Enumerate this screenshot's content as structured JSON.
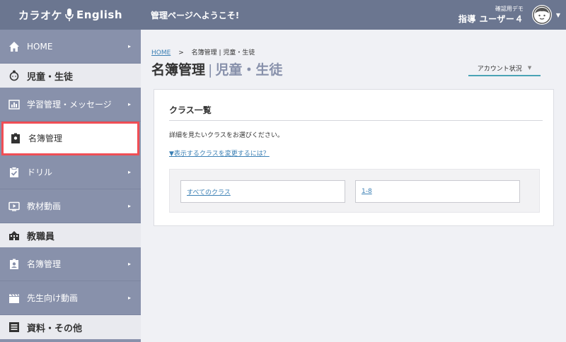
{
  "header": {
    "logo_left": "カラオケ",
    "logo_right": "English",
    "welcome": "管理ページへようこそ!",
    "user_sub": "確認用デモ",
    "user_name": "指導 ユーザー４"
  },
  "sidebar": {
    "home": "HOME",
    "section_students": "児童・生徒",
    "learning": "学習管理・メッセージ",
    "roster": "名簿管理",
    "drill": "ドリル",
    "video": "教材動画",
    "section_staff": "教職員",
    "staff_roster": "名簿管理",
    "teacher_video": "先生向け動画",
    "section_materials": "資料・その他"
  },
  "breadcrumb": {
    "home": "HOME",
    "sep": ">",
    "current": "名簿管理 | 児童・生徒"
  },
  "page": {
    "title": "名簿管理",
    "bar": "|",
    "subtitle": "児童・生徒",
    "account_label": "アカウント状況"
  },
  "card": {
    "title": "クラス一覧",
    "desc": "詳細を見たいクラスをお選びください。",
    "change_link": "▼表示するクラスを変更するには？",
    "classes": [
      "すべてのクラス",
      "1-8"
    ]
  },
  "colors": {
    "header_bg": "#6b7690",
    "sidebar_bg": "#8891ab",
    "highlight": "#f04e55",
    "link": "#3a7fb4"
  }
}
